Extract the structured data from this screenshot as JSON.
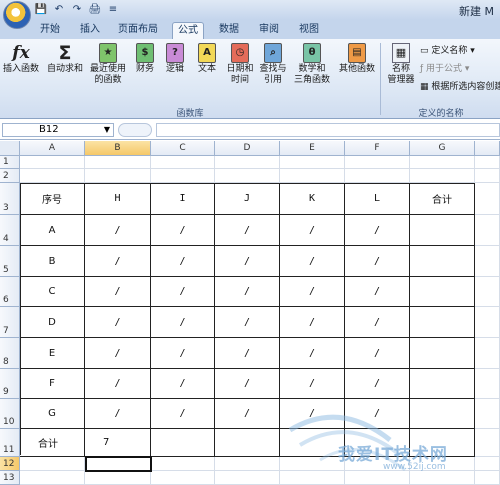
{
  "window": {
    "title": "新建 M"
  },
  "qat": {
    "save": "💾",
    "undo": "↶",
    "redo": "↷",
    "print": "🖨",
    "more": "≡"
  },
  "tabs": [
    "开始",
    "插入",
    "页面布局",
    "公式",
    "数据",
    "审阅",
    "视图"
  ],
  "active_tab": "公式",
  "ribbon": {
    "insert_function": "插入函数",
    "autosum": [
      "自动求和",
      ""
    ],
    "recent": [
      "最近使用",
      "的函数"
    ],
    "financial": "财务",
    "logical": "逻辑",
    "text": "文本",
    "datetime": [
      "日期和",
      "时间"
    ],
    "lookup": [
      "查找与",
      "引用"
    ],
    "math": [
      "数学和",
      "三角函数"
    ],
    "more": "其他函数",
    "name_manager": [
      "名称",
      "管理器"
    ],
    "define_name": "定义名称",
    "use_in_formula": "用于公式",
    "create_from_selection": "根据所选内容创建",
    "group_function_library": "函数库",
    "group_defined_names": "定义的名称"
  },
  "formula_bar": {
    "name_box": "B12",
    "formula": ""
  },
  "columns": [
    "A",
    "B",
    "C",
    "D",
    "E",
    "F",
    "G"
  ],
  "rows": [
    "1",
    "2",
    "3",
    "4",
    "5",
    "6",
    "7",
    "8",
    "9",
    "10",
    "11",
    "12",
    "13"
  ],
  "selected": {
    "column": "B",
    "row": "12"
  },
  "table": {
    "header": [
      "序号",
      "H",
      "I",
      "J",
      "K",
      "L",
      "合计"
    ],
    "body": [
      [
        "A",
        "/",
        "/",
        "/",
        "/",
        "/",
        ""
      ],
      [
        "B",
        "/",
        "/",
        "/",
        "/",
        "/",
        ""
      ],
      [
        "C",
        "/",
        "/",
        "/",
        "/",
        "/",
        ""
      ],
      [
        "D",
        "/",
        "/",
        "/",
        "/",
        "/",
        ""
      ],
      [
        "E",
        "/",
        "/",
        "/",
        "/",
        "/",
        ""
      ],
      [
        "F",
        "/",
        "/",
        "/",
        "/",
        "/",
        ""
      ],
      [
        "G",
        "/",
        "/",
        "/",
        "/",
        "/",
        ""
      ],
      [
        "合计",
        "7",
        "",
        "",
        "",
        "",
        ""
      ]
    ]
  },
  "watermark": {
    "text": "我爱IT技术网",
    "url": "www.52ij.com"
  },
  "colors": {
    "accent": "#f5c869",
    "ribbon": "#dbe6f4",
    "tab_active": "#f5f8fc"
  }
}
